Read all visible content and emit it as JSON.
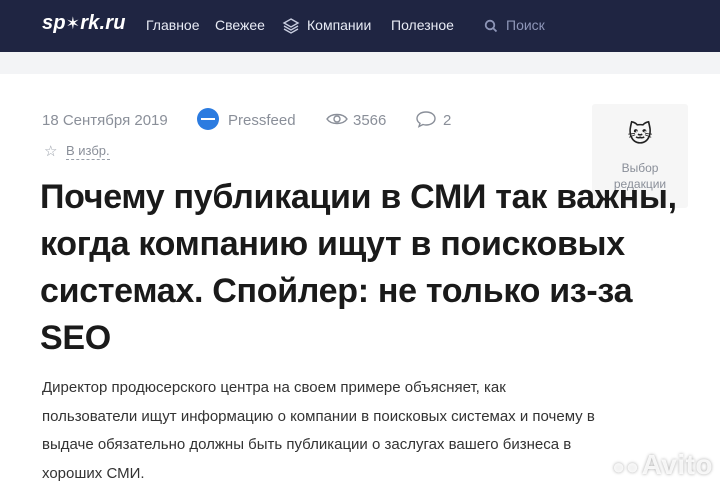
{
  "header": {
    "logo": "sp",
    "logo_star": "✶",
    "logo_rest": "rk.ru",
    "nav": [
      "Главное",
      "Свежее",
      "Компании",
      "Полезное"
    ],
    "search_placeholder": "Поиск"
  },
  "article": {
    "date": "18 Сентября 2019",
    "source": "Pressfeed",
    "views": "3566",
    "comments": "2",
    "favorite_label": "В избр.",
    "title": "Почему публикации в СМИ так важны, когда компанию ищут в поисковых системах. Спойлер: не только из-за SEO",
    "lead": "Директор продюсерского центра на своем примере объясняет, как пользователи ищут информацию о компании в поисковых системах и почему в выдаче обязательно должны быть публикации о заслугах вашего бизнеса в хороших СМИ."
  },
  "editor_badge": {
    "emoji": "🐱",
    "label_line1": "Выбор",
    "label_line2": "редакции"
  },
  "watermark": {
    "text": "Avito",
    "dots": "●●"
  },
  "colors": {
    "topbar": "#1f2542",
    "accent_blue": "#2b7be0",
    "muted": "#8a8f99"
  }
}
